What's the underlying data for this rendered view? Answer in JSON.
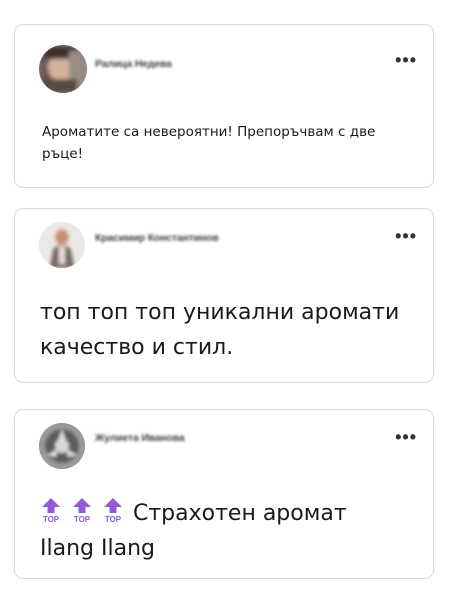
{
  "colors": {
    "card_border": "#d7d7d7",
    "top_emoji_purple": "#8f5bd6"
  },
  "comments": [
    {
      "author": "Ралица Недева",
      "text": "Ароматите са невероятни! Препоръчвам с две ръце!",
      "more_label": "•••"
    },
    {
      "author": "Красимир Константинов",
      "text": "топ топ топ уникални аромати качество и стил.",
      "more_label": "•••"
    },
    {
      "author": "Жулиета Иванова",
      "emoji": [
        "top-emoji",
        "top-emoji",
        "top-emoji"
      ],
      "emoji_label": "TOP",
      "text_line1": "Страхотен аромат",
      "text_line2": "Ilang Ilang",
      "more_label": "•••"
    }
  ]
}
